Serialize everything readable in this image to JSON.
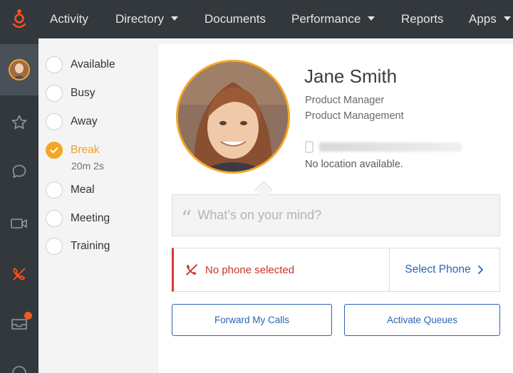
{
  "nav": {
    "items": [
      {
        "label": "Activity"
      },
      {
        "label": "Directory"
      },
      {
        "label": "Documents"
      },
      {
        "label": "Performance"
      },
      {
        "label": "Reports"
      },
      {
        "label": "Apps"
      }
    ]
  },
  "rail": {
    "icons": [
      "avatar",
      "star-icon",
      "chat-icon",
      "video-icon",
      "phone-icon",
      "inbox-icon",
      "help-icon"
    ],
    "inbox_badge_color": "#ee5a24"
  },
  "status": {
    "items": [
      {
        "label": "Available"
      },
      {
        "label": "Busy"
      },
      {
        "label": "Away"
      },
      {
        "label": "Break",
        "selected": true,
        "duration": "20m 2s"
      },
      {
        "label": "Meal"
      },
      {
        "label": "Meeting"
      },
      {
        "label": "Training"
      }
    ]
  },
  "profile": {
    "name": "Jane Smith",
    "title": "Product Manager",
    "department": "Product Management",
    "location": "No location available."
  },
  "post": {
    "placeholder": "What’s on your mind?"
  },
  "phone": {
    "status": "No phone selected",
    "select_label": "Select Phone"
  },
  "actions": {
    "forward_label": "Forward My Calls",
    "queues_label": "Activate Queues"
  },
  "colors": {
    "accent": "#f5a623",
    "brand": "#ff4f1f",
    "link": "#2a65b2",
    "error": "#d33b32",
    "nav_bg": "#33383d"
  }
}
